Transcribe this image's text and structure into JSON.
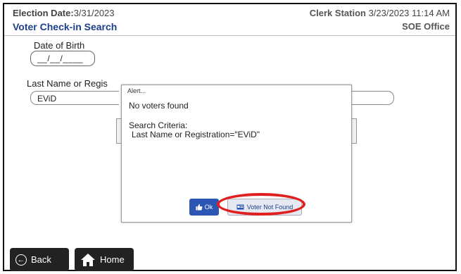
{
  "header": {
    "election_label": "Election Date:",
    "election_date": "3/31/2023",
    "title": "Voter Check-in Search",
    "station_label": "Clerk Station",
    "station_datetime": "3/23/2023 11:14 AM",
    "office": "SOE Office"
  },
  "form": {
    "dob_label": "Date of Birth",
    "dob_value": "__/__/____",
    "lastname_label": "Last Name or Regis",
    "lastname_value": "EViD"
  },
  "dialog": {
    "title": "Alert...",
    "message": "No voters found",
    "criteria_heading": "Search Criteria:",
    "criteria_value": "Last Name or Registration=\"EViD\"",
    "ok_label": "Ok",
    "voter_not_found_label": "Voter Not Found"
  },
  "nav": {
    "back_label": "Back",
    "home_label": "Home"
  },
  "colors": {
    "title_blue": "#1f3f8a",
    "ok_blue": "#2b56b5",
    "highlight_red": "#e02020"
  },
  "icons": {
    "ok": "thumbs-up-icon",
    "voter_not_found": "id-card-icon",
    "back": "arrow-left-circle-icon",
    "home": "house-icon"
  }
}
